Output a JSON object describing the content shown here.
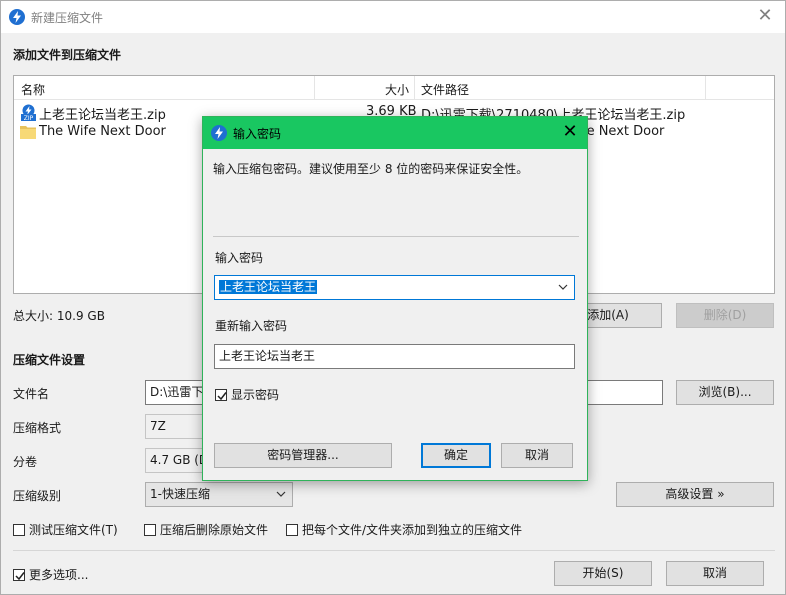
{
  "window": {
    "title": "新建压缩文件",
    "close_glyph": "✕",
    "app_icon": "bandizip-icon"
  },
  "add_section": {
    "title": "添加文件到压缩文件"
  },
  "file_list": {
    "columns": {
      "name": "名称",
      "size": "大小",
      "path": "文件路径"
    },
    "rows": [
      {
        "name": "上老王论坛当老王.zip",
        "size": "3.69 KB",
        "path": "D:\\迅雷下载\\2710480\\上老王论坛当老王.zip",
        "icon": "zip-icon"
      },
      {
        "name": "The Wife Next Door",
        "size": "",
        "path": "fe Next Door",
        "icon": "folder-icon"
      }
    ]
  },
  "total_size": "总大小: 10.9 GB",
  "buttons": {
    "add": "添加(A)",
    "delete": "删除(D)",
    "browse": "浏览(B)...",
    "advanced": "高级设置 »",
    "start": "开始(S)",
    "cancel": "取消"
  },
  "settings": {
    "title": "压缩文件设置",
    "filename_label": "文件名",
    "filename_value": "D:\\迅雷下",
    "format_label": "压缩格式",
    "format_value": "7Z",
    "split_label": "分卷",
    "split_value": "4.7 GB (D",
    "level_label": "压缩级别",
    "level_value": "1-快速压缩"
  },
  "options": {
    "test": "测试压缩文件(T)",
    "delete_after": "压缩后删除原始文件",
    "each_separate": "把每个文件/文件夹添加到独立的压缩文件",
    "more": "更多选项..."
  },
  "dialog": {
    "title": "输入密码",
    "close_glyph": "✕",
    "description": "输入压缩包密码。建议使用至少 8 位的密码来保证安全性。",
    "password_label": "输入密码",
    "password_value": "上老王论坛当老王",
    "reenter_label": "重新输入密码",
    "reenter_value": "上老王论坛当老王",
    "show_password": "显示密码",
    "manager_button": "密码管理器...",
    "ok_button": "确定",
    "cancel_button": "取消"
  },
  "colors": {
    "dialog_title_bg": "#19c761",
    "accent": "#0078d7"
  }
}
